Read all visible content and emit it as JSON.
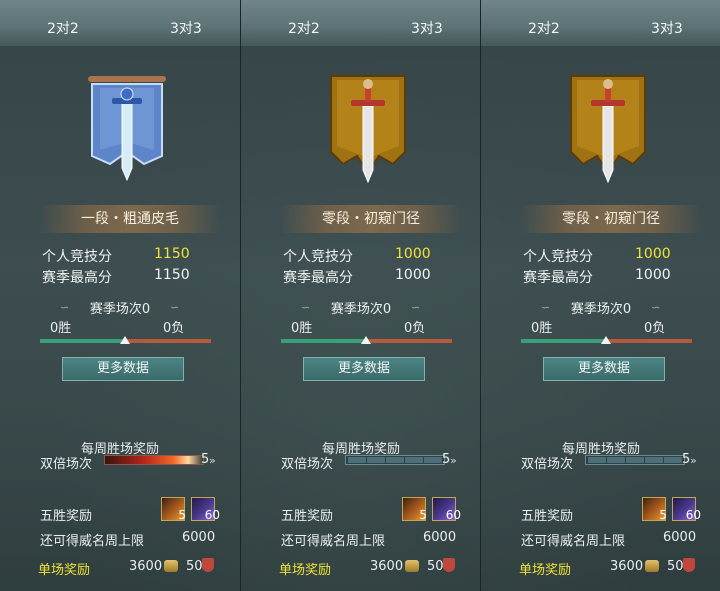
{
  "tabs": [
    "2对2",
    "3对3"
  ],
  "panels": [
    {
      "emblem": "blue-banner-sword-icon",
      "rank": "一段・粗通皮毛",
      "personal_label": "个人竞技分",
      "personal_value": "1150",
      "best_label": "赛季最高分",
      "best_value": "1150",
      "season_label": "赛季场次0",
      "wins": "0胜",
      "losses": "0负",
      "more_btn": "更多数据",
      "weekly_label": "每周胜场奖励",
      "double_label": "双倍场次",
      "double_count": "5",
      "five_win_label": "五胜奖励",
      "item1_count": "5",
      "item2_count": "60",
      "cap_label": "还可得威名周上限",
      "cap_value": "6000",
      "single_label": "单场奖励",
      "single_value1": "3600",
      "single_value2": "50"
    },
    {
      "emblem": "gold-banner-sword-icon",
      "rank": "零段・初窥门径",
      "personal_label": "个人竞技分",
      "personal_value": "1000",
      "best_label": "赛季最高分",
      "best_value": "1000",
      "season_label": "赛季场次0",
      "wins": "0胜",
      "losses": "0负",
      "more_btn": "更多数据",
      "weekly_label": "每周胜场奖励",
      "double_label": "双倍场次",
      "double_count": "5",
      "five_win_label": "五胜奖励",
      "item1_count": "5",
      "item2_count": "60",
      "cap_label": "还可得威名周上限",
      "cap_value": "6000",
      "single_label": "单场奖励",
      "single_value1": "3600",
      "single_value2": "50"
    },
    {
      "emblem": "gold-banner-sword-icon",
      "rank": "零段・初窥门径",
      "personal_label": "个人竞技分",
      "personal_value": "1000",
      "best_label": "赛季最高分",
      "best_value": "1000",
      "season_label": "赛季场次0",
      "wins": "0胜",
      "losses": "0负",
      "more_btn": "更多数据",
      "weekly_label": "每周胜场奖励",
      "double_label": "双倍场次",
      "double_count": "5",
      "five_win_label": "五胜奖励",
      "item1_count": "5",
      "item2_count": "60",
      "cap_label": "还可得威名周上限",
      "cap_value": "6000",
      "single_label": "单场奖励",
      "single_value1": "3600",
      "single_value2": "50"
    }
  ],
  "colors": {
    "highlight": "#f0e237",
    "win_bar": "#3aa07a",
    "loss_bar": "#b55a3a",
    "button": "#3b6b6b"
  }
}
